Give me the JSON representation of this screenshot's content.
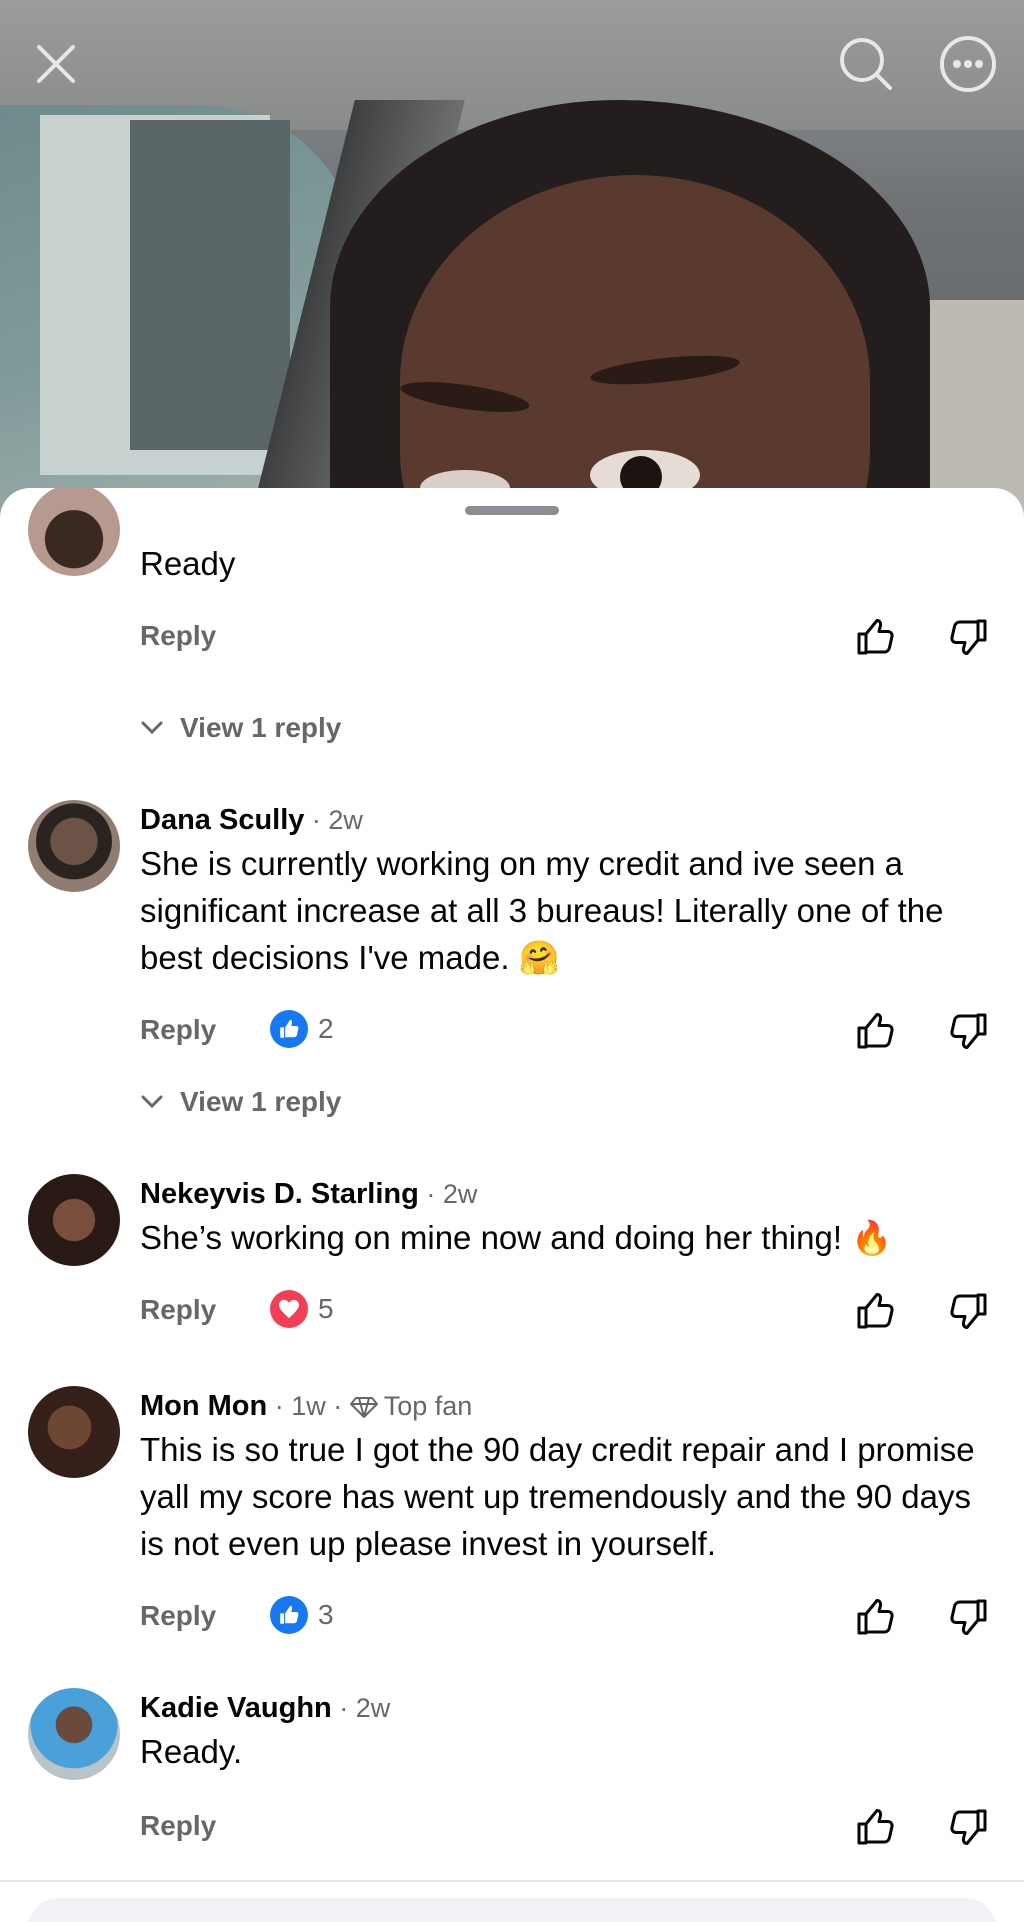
{
  "video": {
    "close_icon": "close-icon",
    "search_icon": "search-icon",
    "more_icon": "more-options-icon"
  },
  "labels": {
    "reply": "Reply",
    "view_replies": "View 1 reply"
  },
  "colors": {
    "like_blue": "#1877f2",
    "love_red": "#f33e58",
    "secondary_text": "#65676b"
  },
  "comments": [
    {
      "name": "",
      "time": "",
      "text": "Ready",
      "reaction": null,
      "count": "",
      "view_replies": "View 1 reply"
    },
    {
      "name": "Dana Scully",
      "time": "2w",
      "text": "She is currently working on my credit and ive seen a significant increase at all 3 bureaus! Literally one of the best decisions I've made. 🤗",
      "reaction": "like",
      "count": "2",
      "view_replies": "View 1 reply"
    },
    {
      "name": "Nekeyvis D. Starling",
      "time": "2w",
      "text": "She’s working on mine now and doing her thing! 🔥",
      "reaction": "love",
      "count": "5",
      "view_replies": ""
    },
    {
      "name": "Mon Mon",
      "time": "1w",
      "badge": "Top fan",
      "text": "This is so true I got the 90 day credit repair and I promise yall my score has went up tremendously and the 90 days is not even up please invest in yourself.",
      "reaction": "like",
      "count": "3",
      "view_replies": ""
    },
    {
      "name": "Kadie Vaughn",
      "time": "2w",
      "text": "Ready.",
      "reaction": null,
      "count": "",
      "view_replies": ""
    }
  ]
}
